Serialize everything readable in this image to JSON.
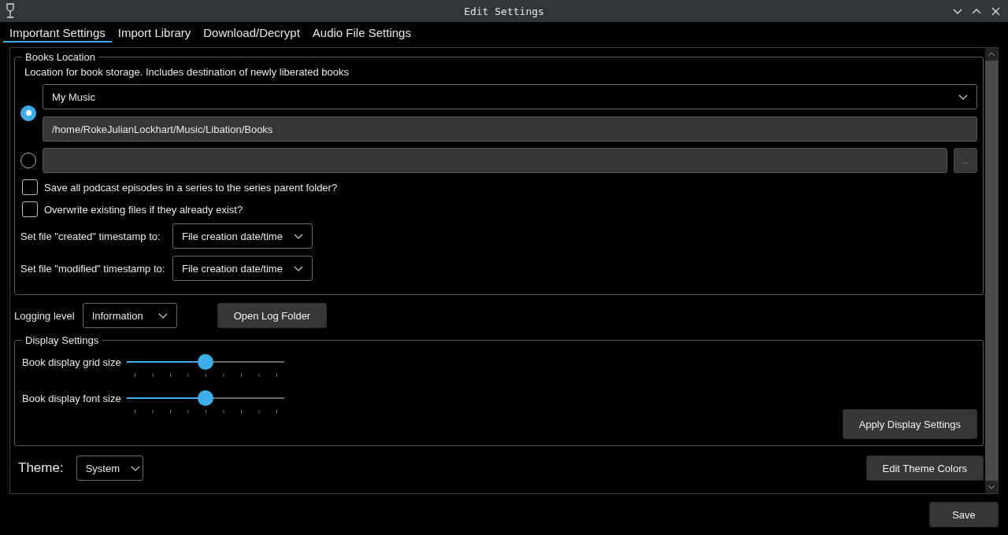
{
  "window": {
    "title": "Edit Settings"
  },
  "tabs": [
    {
      "label": "Important Settings",
      "selected": true
    },
    {
      "label": "Import Library",
      "selected": false
    },
    {
      "label": "Download/Decrypt",
      "selected": false
    },
    {
      "label": "Audio File Settings",
      "selected": false
    }
  ],
  "books_location": {
    "title": "Books Location",
    "description": "Location for book storage. Includes destination of newly liberated books",
    "options": [
      {
        "kind": "preset",
        "selected": true,
        "dropdown": "My Music",
        "path": "/home/RokeJulianLockhart/Music/Libation/Books"
      },
      {
        "kind": "custom",
        "selected": false,
        "browse_button": "..."
      }
    ],
    "checkboxes": [
      {
        "label": "Save all podcast episodes in a series to the series parent folder?",
        "checked": false
      },
      {
        "label": "Overwrite existing files if they already exist?",
        "checked": false
      }
    ],
    "timestamps": [
      {
        "label": "Set file \"created\" timestamp to:",
        "value": "File creation date/time"
      },
      {
        "label": "Set file \"modified\" timestamp to:",
        "value": "File creation date/time"
      }
    ]
  },
  "logging": {
    "label": "Logging level",
    "value": "Information",
    "button": "Open Log Folder"
  },
  "display_settings": {
    "title": "Display Settings",
    "sliders": [
      {
        "label": "Book display grid size",
        "level": 0.5
      },
      {
        "label": "Book display font size",
        "level": 0.5
      }
    ],
    "apply_button": "Apply Display Settings"
  },
  "theme": {
    "label": "Theme:",
    "value": "System",
    "button": "Edit Theme Colors"
  },
  "save_button": "Save"
}
